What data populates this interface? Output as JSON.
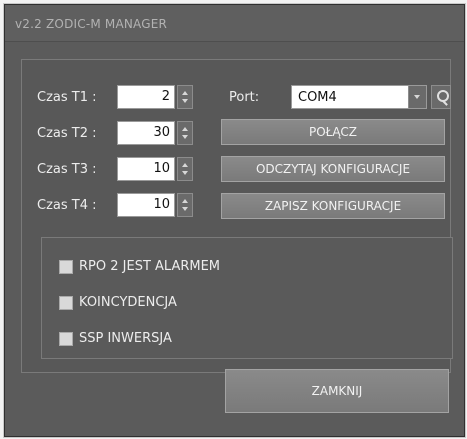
{
  "window": {
    "title": "v2.2 ZODIC-M MANAGER"
  },
  "timers": [
    {
      "label": "Czas T1 :",
      "value": "2"
    },
    {
      "label": "Czas T2 :",
      "value": "30"
    },
    {
      "label": "Czas T3 :",
      "value": "10"
    },
    {
      "label": "Czas T4 :",
      "value": "10"
    }
  ],
  "port": {
    "label": "Port:",
    "value": "COM4",
    "search_icon": "search-icon",
    "dropdown_icon": "chevron-down-icon"
  },
  "buttons": {
    "connect": "POŁĄCZ",
    "read_config": "ODCZYTAJ KONFIGURACJE",
    "save_config": "ZAPISZ KONFIGURACJE",
    "close": "ZAMKNIJ"
  },
  "checkboxes": [
    {
      "label": "RPO 2 JEST ALARMEM",
      "checked": false
    },
    {
      "label": "KOINCYDENCJA",
      "checked": false
    },
    {
      "label": "SSP INWERSJA",
      "checked": false
    }
  ],
  "colors": {
    "window_bg": "#5b5b5b",
    "panel_border": "#7a7a7a",
    "text": "#ededed",
    "input_bg": "#ffffff"
  }
}
